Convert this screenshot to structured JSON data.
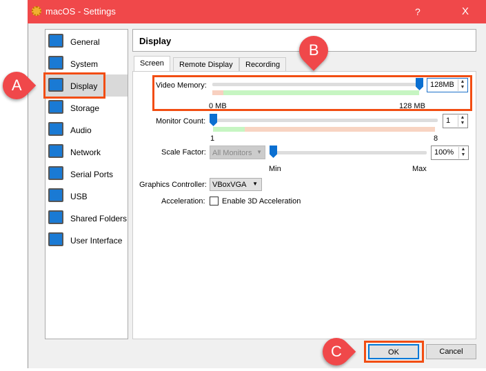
{
  "window": {
    "title": "macOS - Settings",
    "help": "?",
    "close": "X"
  },
  "sidebar": {
    "items": [
      {
        "label": "General",
        "icon": "general-monitor-icon"
      },
      {
        "label": "System",
        "icon": "chip-icon"
      },
      {
        "label": "Display",
        "icon": "display-monitor-icon",
        "selected": true
      },
      {
        "label": "Storage",
        "icon": "disk-icon"
      },
      {
        "label": "Audio",
        "icon": "speaker-icon"
      },
      {
        "label": "Network",
        "icon": "network-icon"
      },
      {
        "label": "Serial Ports",
        "icon": "serial-port-icon"
      },
      {
        "label": "USB",
        "icon": "usb-icon"
      },
      {
        "label": "Shared Folders",
        "icon": "folder-icon"
      },
      {
        "label": "User Interface",
        "icon": "ui-window-icon"
      }
    ]
  },
  "header": {
    "title": "Display"
  },
  "tabs": [
    "Screen",
    "Remote Display",
    "Recording"
  ],
  "screen": {
    "video_memory": {
      "label": "Video Memory:",
      "value": "128",
      "unit": "MB",
      "min_label": "0 MB",
      "max_label": "128 MB",
      "fraction": 1.0
    },
    "monitor_count": {
      "label": "Monitor Count:",
      "value": "1",
      "min_label": "1",
      "max_label": "8",
      "fraction": 0
    },
    "scale_factor": {
      "label": "Scale Factor:",
      "select": "All Monitors",
      "value": "100%",
      "min_label": "Min",
      "max_label": "Max",
      "fraction": 0
    },
    "graphics_controller": {
      "label": "Graphics Controller:",
      "value": "VBoxVGA"
    },
    "acceleration": {
      "label": "Acceleration:",
      "checkbox_label": "Enable 3D Acceleration",
      "checked": false
    }
  },
  "buttons": {
    "ok": "OK",
    "cancel": "Cancel"
  },
  "annotations": {
    "a": "A",
    "b": "B",
    "c": "C"
  }
}
